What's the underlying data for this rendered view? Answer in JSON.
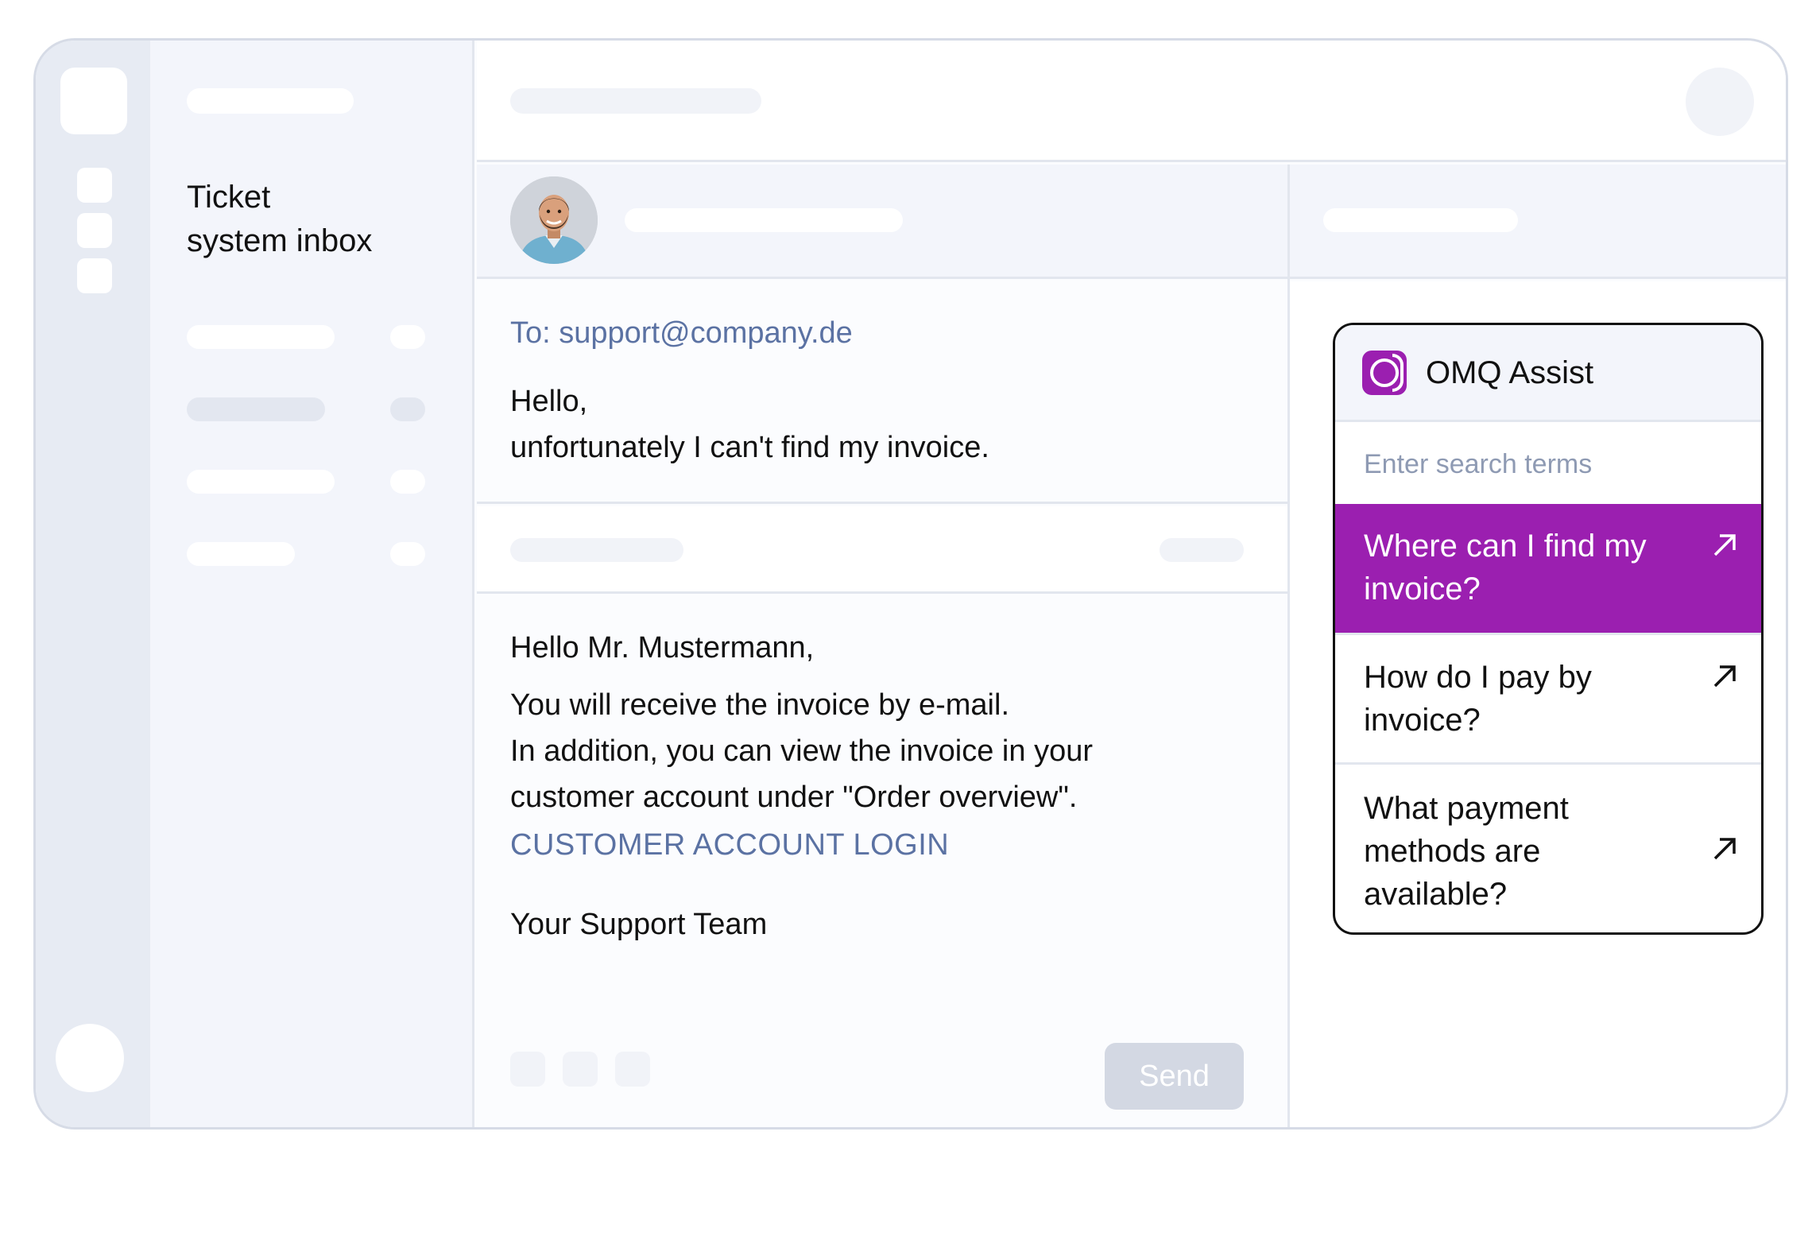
{
  "sidebar": {
    "title_line1": "Ticket",
    "title_line2": "system inbox"
  },
  "email": {
    "to": "To: support@company.de",
    "body": [
      "Hello,",
      "unfortunately I can't find my invoice."
    ]
  },
  "reply": {
    "greeting": "Hello Mr. Mustermann,",
    "lines": [
      "You will receive the invoice by e-mail.",
      "In addition, you can view the invoice in your",
      "customer account under \"Order overview\"."
    ],
    "link": "CUSTOMER ACCOUNT LOGIN",
    "signature": "Your Support Team",
    "send_label": "Send"
  },
  "assist": {
    "title": "OMQ Assist",
    "logo_icon": "omq-logo-icon",
    "search_placeholder": "Enter search terms",
    "accent_color": "#9b1fb0",
    "results": [
      {
        "text": "Where can I find my invoice?",
        "active": true
      },
      {
        "text": "How do I pay by invoice?",
        "active": false
      },
      {
        "text": "What payment methods are available?",
        "active": false
      }
    ]
  },
  "colors": {
    "link": "#5b72a3",
    "rail": "#e7ebf3",
    "frame_border": "#d6dbe6"
  }
}
